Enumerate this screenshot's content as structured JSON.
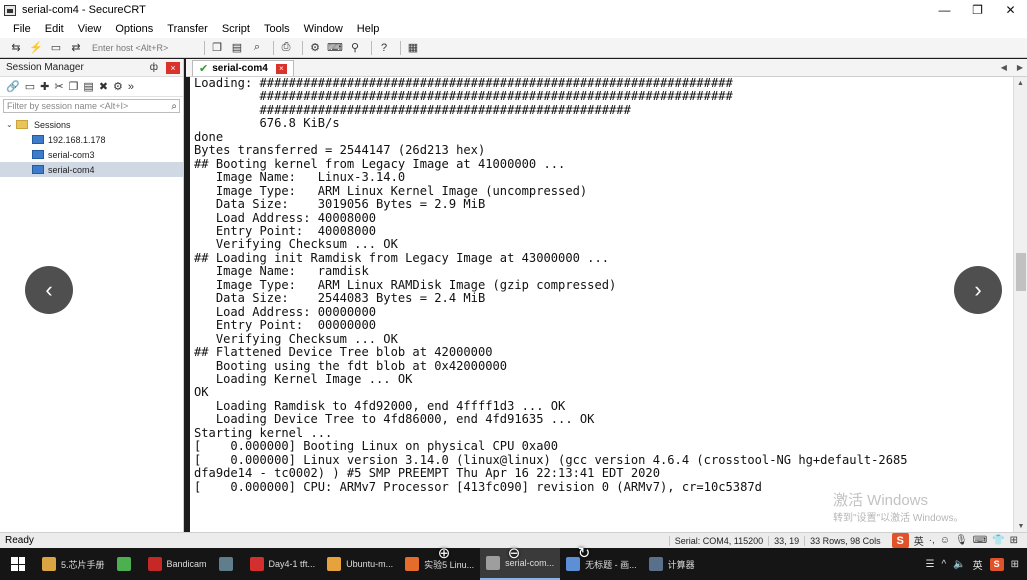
{
  "window": {
    "title": "serial-com4 - SecureCRT",
    "controls": [
      "—",
      "❐",
      "✕"
    ]
  },
  "menu": [
    "File",
    "Edit",
    "View",
    "Options",
    "Transfer",
    "Script",
    "Tools",
    "Window",
    "Help"
  ],
  "toolbar": {
    "host_placeholder": "Enter host <Alt+R>",
    "icons_left": [
      "connect-icon",
      "quick-connect-icon",
      "disconnect-icon",
      "reconnect-icon"
    ],
    "icons_right": [
      "copy-icon",
      "paste-icon",
      "find-icon",
      "print-icon",
      "settings-icon",
      "keymap-icon",
      "filter-icon",
      "help-icon",
      "script-icon"
    ]
  },
  "session_manager": {
    "title": "Session Manager",
    "pin": "ф",
    "close": "×",
    "filter_placeholder": "Filter by session name <Alt+I>",
    "tree": {
      "root": "Sessions",
      "items": [
        "192.168.1.178",
        "serial-com3",
        "serial-com4"
      ],
      "selected": "serial-com4"
    }
  },
  "tab": {
    "label": "serial-com4",
    "check": "✔",
    "close": "×"
  },
  "terminal": {
    "lines": [
      "Loading: #################################################################",
      "         #################################################################",
      "         ###################################################",
      "         676.8 KiB/s",
      "done",
      "Bytes transferred = 2544147 (26d213 hex)",
      "## Booting kernel from Legacy Image at 41000000 ...",
      "   Image Name:   Linux-3.14.0",
      "   Image Type:   ARM Linux Kernel Image (uncompressed)",
      "   Data Size:    3019056 Bytes = 2.9 MiB",
      "   Load Address: 40008000",
      "   Entry Point:  40008000",
      "   Verifying Checksum ... OK",
      "## Loading init Ramdisk from Legacy Image at 43000000 ...",
      "   Image Name:   ramdisk",
      "   Image Type:   ARM Linux RAMDisk Image (gzip compressed)",
      "   Data Size:    2544083 Bytes = 2.4 MiB",
      "   Load Address: 00000000",
      "   Entry Point:  00000000",
      "   Verifying Checksum ... OK",
      "## Flattened Device Tree blob at 42000000",
      "   Booting using the fdt blob at 0x42000000",
      "   Loading Kernel Image ... OK",
      "OK",
      "   Loading Ramdisk to 4fd92000, end 4ffff1d3 ... OK",
      "   Loading Device Tree to 4fd86000, end 4fd91635 ... OK",
      "",
      "Starting kernel ...",
      "",
      "[    0.000000] Booting Linux on physical CPU 0xa00",
      "[    0.000000] Linux version 3.14.0 (linux@linux) (gcc version 4.6.4 (crosstool-NG hg+default-2685",
      "dfa9de14 - tc0002) ) #5 SMP PREEMPT Thu Apr 16 22:13:41 EDT 2020",
      "[    0.000000] CPU: ARMv7 Processor [413fc090] revision 0 (ARMv7), cr=10c5387d"
    ]
  },
  "watermark": {
    "line1": "激活 Windows",
    "line2": "转到\"设置\"以激活 Windows。"
  },
  "statusbar": {
    "ready": "Ready",
    "connection": "Serial: COM4, 115200",
    "cursor": "33, 19",
    "size": "33 Rows, 98 Cols",
    "ime": [
      "英",
      "·,",
      "☺",
      "🎙",
      "⌨",
      "👕",
      "⊞"
    ]
  },
  "taskbar": {
    "items": [
      {
        "label": "5.芯片手册",
        "color": "#d9a441"
      },
      {
        "label": "",
        "color": "#4caf50"
      },
      {
        "label": "Bandicam",
        "color": "#c62828"
      },
      {
        "label": "",
        "color": "#607d8b"
      },
      {
        "label": "Day4-1 tft...",
        "color": "#d32f2f"
      },
      {
        "label": "Ubuntu-m...",
        "color": "#e6a23c"
      },
      {
        "label": "实验5 Linu...",
        "color": "#e66c2c"
      },
      {
        "label": "serial-com...",
        "color": "#9e9e9e"
      },
      {
        "label": "无标题 - 画...",
        "color": "#5d8fd6"
      },
      {
        "label": "计算器",
        "color": "#5a6f8a"
      }
    ],
    "active_index": 7,
    "tray": [
      "☰",
      "^",
      "🔈",
      "英",
      "S",
      "⊞"
    ]
  },
  "overlay": {
    "prev": "‹",
    "next": "›",
    "zoom_in": "⊕",
    "zoom_out": "⊖",
    "rotate": "↻"
  }
}
